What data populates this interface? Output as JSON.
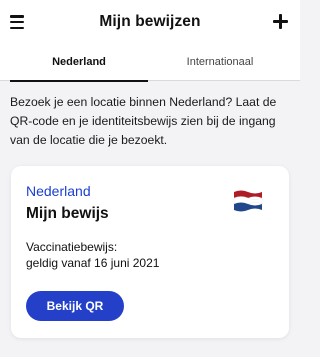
{
  "header": {
    "title": "Mijn bewijzen",
    "menu_icon": "hamburger-menu-icon",
    "add_icon": "plus-icon"
  },
  "tabs": [
    {
      "label": "Nederland",
      "active": true
    },
    {
      "label": "Internationaal",
      "active": false
    }
  ],
  "intro_text": "Bezoek je een locatie binnen Nederland? Laat de QR-code en je identiteitsbewijs zien bij de ingang van de locatie die je bezoekt.",
  "card": {
    "country": "Nederland",
    "title": "Mijn bewijs",
    "flag_icon": "netherlands-flag-icon",
    "type_line": "Vaccinatiebewijs:",
    "valid_line": "geldig vanaf 16 juni 2021",
    "button_label": "Bekijk QR"
  },
  "colors": {
    "accent": "#2440c9",
    "country_text": "#1a3fd0",
    "background": "#f3f3f6",
    "flag_red": "#ae1c28",
    "flag_white": "#ffffff",
    "flag_blue": "#21468b"
  }
}
